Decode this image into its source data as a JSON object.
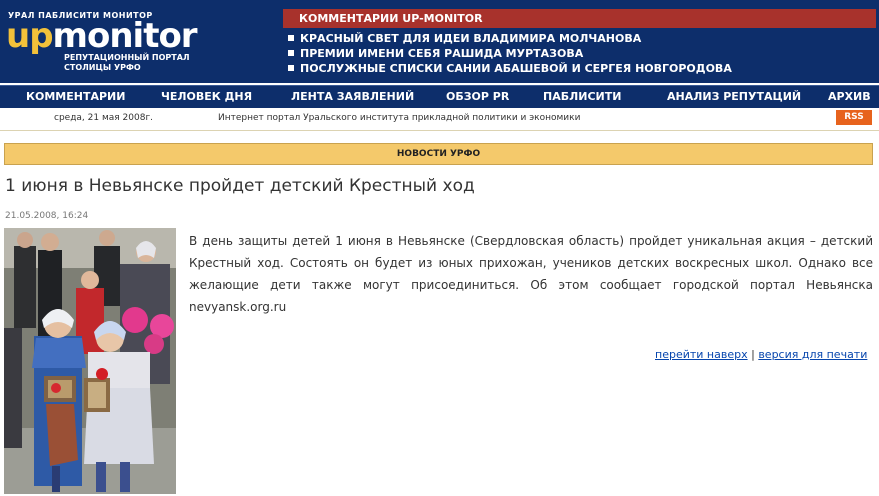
{
  "logo": {
    "tagline_top": "УРАЛ ПАБЛИСИТИ МОНИТОР",
    "up": "up",
    "monitor": "monitor",
    "subtitle_line1": "РЕПУТАЦИОННЫЙ ПОРТАЛ",
    "subtitle_line2": "СТОЛИЦЫ УРФО"
  },
  "comments": {
    "header": "КОММЕНТАРИИ UP-MONITOR",
    "items": [
      "КРАСНЫЙ СВЕТ ДЛЯ ИДЕИ ВЛАДИМИРА МОЛЧАНОВА",
      "ПРЕМИИ ИМЕНИ СЕБЯ РАШИДА МУРТАЗОВА",
      "ПОСЛУЖНЫЕ СПИСКИ САНИИ АБАШЕВОЙ И СЕРГЕЯ НОВГОРОДОВА"
    ]
  },
  "nav": {
    "items": [
      "КОММЕНТАРИИ",
      "ЧЕЛОВЕК ДНЯ",
      "ЛЕНТА ЗАЯВЛЕНИЙ",
      "ОБЗОР PR",
      "ПАБЛИСИТИ",
      "АНАЛИЗ РЕПУТАЦИЙ",
      "АРХИВ"
    ]
  },
  "info": {
    "date": "среда, 21 мая 2008г.",
    "portal": "Интернет портал Уральского института прикладной политики и экономики",
    "rss": "RSS"
  },
  "section": {
    "title": "НОВОСТИ УРФО"
  },
  "article": {
    "title": "1 июня в Невьянске пройдет детский Крестный ход",
    "timestamp": "21.05.2008, 16:24",
    "body": "В день защиты детей 1 июня в Невьянске (Свердловская область) пройдет уникальная акция – детский Крестный ход. Состоять он будет из юных прихожан, учеников детских воскресных школ. Однако все желающие дети также могут присоединиться. Об этом сообщает городской портал Невьянска nevyansk.org.ru",
    "link_top": "перейти наверх",
    "separator": "|",
    "link_print": "версия для печати"
  },
  "colors": {
    "header_bg": "#0d2e6b",
    "comment_bar": "#a8322c",
    "section_bar": "#f4c96b",
    "rss": "#e7631d",
    "logo_accent": "#f2c13a"
  }
}
